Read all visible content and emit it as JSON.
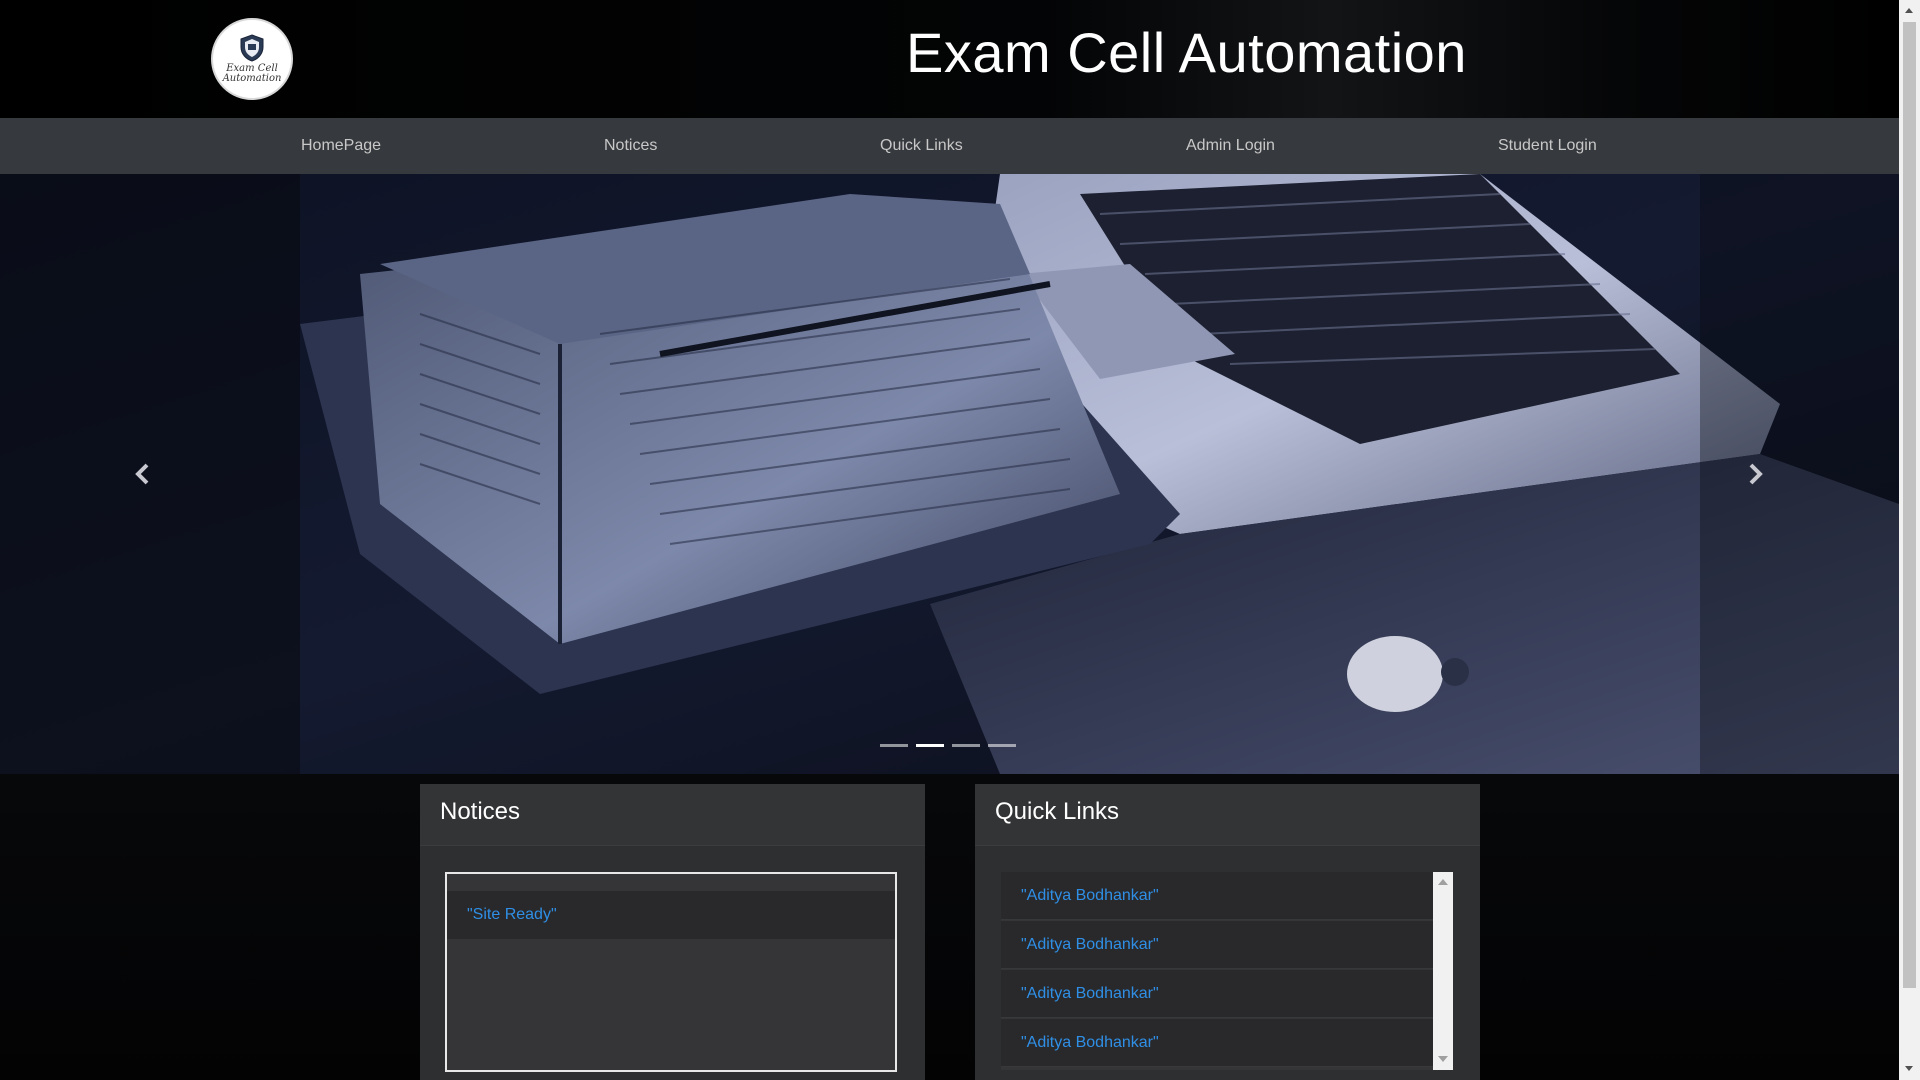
{
  "header": {
    "title": "Exam Cell Automation",
    "logo_text_line1": "Exam Cell",
    "logo_text_line2": "Automation"
  },
  "nav": {
    "items": [
      {
        "label": "HomePage"
      },
      {
        "label": "Notices"
      },
      {
        "label": "Quick Links"
      },
      {
        "label": "Admin Login"
      },
      {
        "label": "Student Login"
      }
    ]
  },
  "carousel": {
    "slide_count": 4,
    "active_index": 1,
    "prev_icon": "chevron-left-icon",
    "next_icon": "chevron-right-icon"
  },
  "notices": {
    "heading": "Notices",
    "items": [
      {
        "text": "\"Site Ready\""
      }
    ]
  },
  "quick_links": {
    "heading": "Quick Links",
    "items": [
      {
        "text": "\"Aditya Bodhankar\""
      },
      {
        "text": "\"Aditya Bodhankar\""
      },
      {
        "text": "\"Aditya Bodhankar\""
      },
      {
        "text": "\"Aditya Bodhankar\""
      }
    ]
  },
  "colors": {
    "header_bg": "#000000",
    "navbar_bg": "#36393d",
    "nav_text": "#c8c8c8",
    "panel_bg": "#2e2f31",
    "link_blue": "#2f8fe6",
    "title_white": "#ffffff"
  }
}
